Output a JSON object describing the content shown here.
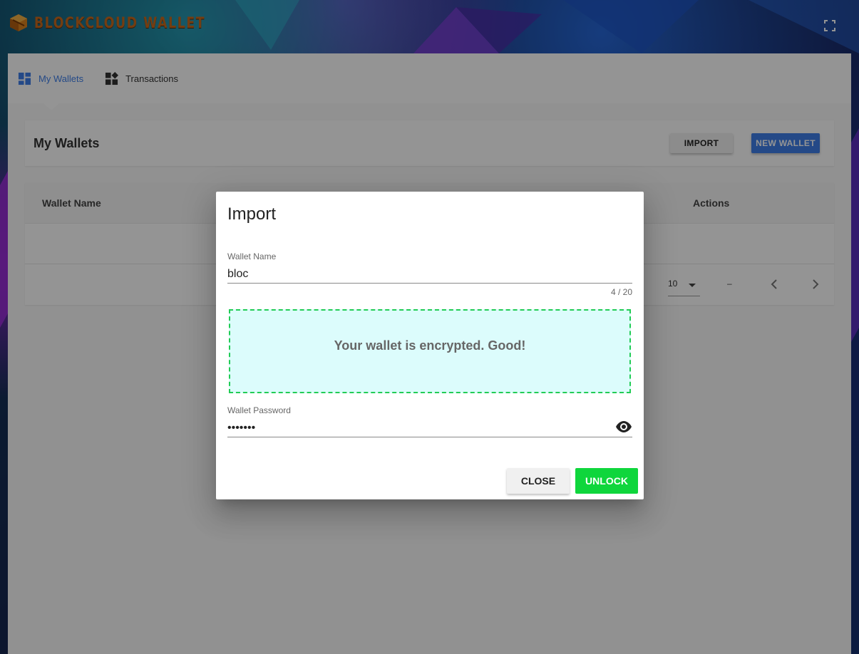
{
  "app": {
    "brand": "BLOCKCLOUD WALLET"
  },
  "nav": {
    "items": [
      {
        "label": "My Wallets",
        "icon": "dashboard-icon",
        "active": true
      },
      {
        "label": "Transactions",
        "icon": "widgets-icon",
        "active": false
      }
    ]
  },
  "page": {
    "title": "My Wallets",
    "import_label": "IMPORT",
    "new_wallet_label": "NEW WALLET"
  },
  "table": {
    "columns": [
      "Wallet Name",
      "Actions"
    ],
    "page_size": "10",
    "range_text": "–"
  },
  "dialog": {
    "title": "Import",
    "wallet_name_label": "Wallet Name",
    "wallet_name_value": "bloc",
    "char_count": "4 / 20",
    "drop_message": "Your wallet is encrypted. Good!",
    "password_label": "Wallet Password",
    "password_value": "mypass1",
    "close_label": "CLOSE",
    "unlock_label": "UNLOCK"
  },
  "colors": {
    "accent": "#3f7fe8",
    "success": "#0fd63c",
    "drop_bg": "#dcfcfc",
    "drop_border": "#22cc55",
    "brand": "#c86a1e"
  }
}
